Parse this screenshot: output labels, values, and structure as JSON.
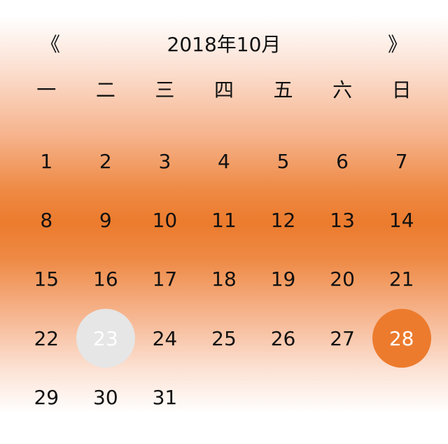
{
  "header": {
    "prev_label": "《",
    "title": "2018年10月",
    "next_label": "》"
  },
  "weekdays": [
    "一",
    "二",
    "三",
    "四",
    "五",
    "六",
    "日"
  ],
  "days": {
    "leading_blanks": 0,
    "list": [
      "1",
      "2",
      "3",
      "4",
      "5",
      "6",
      "7",
      "8",
      "9",
      "10",
      "11",
      "12",
      "13",
      "14",
      "15",
      "16",
      "17",
      "18",
      "19",
      "20",
      "21",
      "22",
      "23",
      "24",
      "25",
      "26",
      "27",
      "28",
      "29",
      "30",
      "31"
    ],
    "today": "23",
    "selected": "28"
  },
  "colors": {
    "accent": "#ec7b2d",
    "today_bg": "#e6e6e6",
    "text": "#111111"
  }
}
